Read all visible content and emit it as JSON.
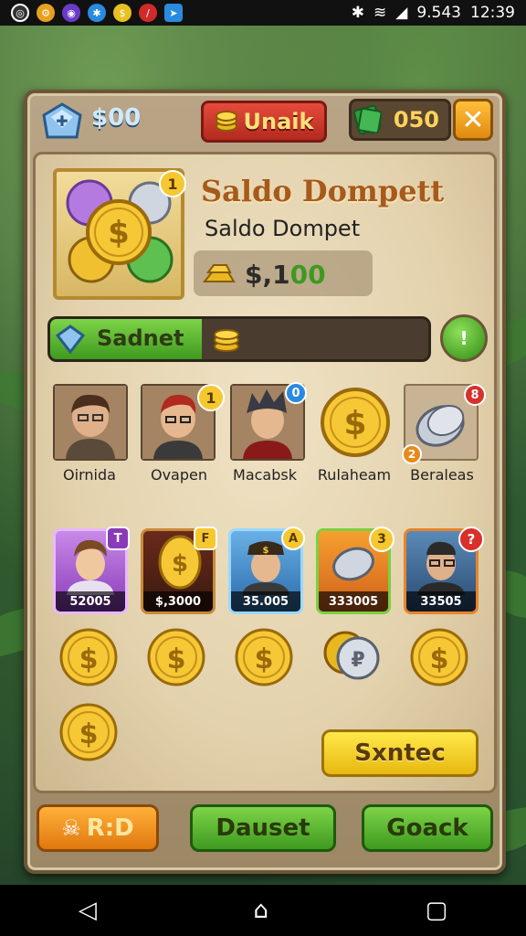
{
  "status_bar": {
    "battery_text": "9.543",
    "time": "12:39"
  },
  "header": {
    "money": "$00",
    "unlock_button": "Unaik",
    "cash_value": "050",
    "close_icon": "✕"
  },
  "wallet": {
    "badge": "1",
    "title": "Saldo Dompett",
    "subtitle": "Saldo Dompet",
    "balance_prefix": "$,1",
    "balance_highlight": "00"
  },
  "progress": {
    "label": "Sadnet",
    "fill_percent": 40
  },
  "portraits": [
    {
      "label": "Oirnida",
      "badge": ""
    },
    {
      "label": "Ovapen",
      "badge": "1"
    },
    {
      "label": "Macabsk",
      "badge": "0"
    },
    {
      "label": "Rulaheam",
      "badge": ""
    },
    {
      "label": "Beraleas",
      "badge": "8",
      "badge2": "2"
    }
  ],
  "cards": [
    {
      "value": "52005",
      "badge": "T"
    },
    {
      "value": "$,3000",
      "badge": "F"
    },
    {
      "value": "35.005",
      "badge": "A"
    },
    {
      "value": "333005",
      "badge": "3"
    },
    {
      "value": "33505",
      "badge": "?"
    }
  ],
  "buttons": {
    "yellow": "Sxntec",
    "orange": "R:D",
    "green1": "Dauset",
    "green2": "Goack"
  },
  "colors": {
    "accent_red": "#c0342a",
    "accent_green": "#3e9a1f",
    "accent_yellow": "#e8b810",
    "accent_orange": "#e88a1a"
  }
}
